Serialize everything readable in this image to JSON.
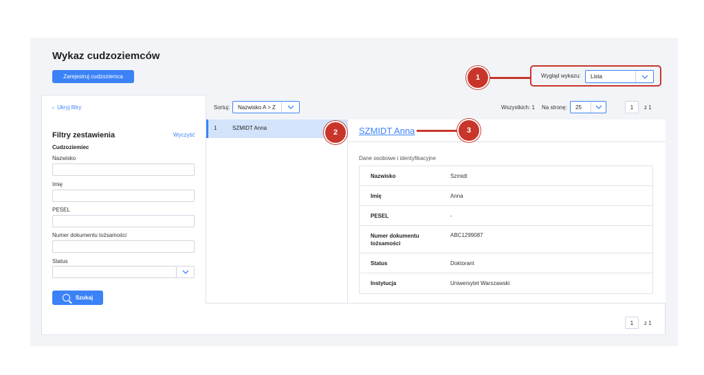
{
  "header": {
    "title": "Wykaz cudzoziemców",
    "register_label": "Zarejestruj cudzoziemca"
  },
  "view": {
    "label": "Wygląd wykazu:",
    "selected": "Lista"
  },
  "annotations": [
    "1",
    "2",
    "3"
  ],
  "filters": {
    "hide_label": "Ukryj filtry",
    "title": "Filtry zestawienia",
    "clear_label": "Wyczyść",
    "subtitle": "Cudzoziemiec",
    "fields": [
      {
        "label": "Nazwisko",
        "value": ""
      },
      {
        "label": "Imię",
        "value": ""
      },
      {
        "label": "PESEL",
        "value": ""
      },
      {
        "label": "Numer dokumentu tożsamości",
        "value": ""
      }
    ],
    "status_label": "Status",
    "status_value": "",
    "search_label": "Szukaj"
  },
  "toolbar": {
    "sort_label": "Sortuj:",
    "sort_value": "Nazwisko A > Z",
    "total_label": "Wszystkich: 1",
    "perpage_label": "Na stronę:",
    "perpage_value": "25",
    "page": "1",
    "page_of": "z 1"
  },
  "list": {
    "items": [
      {
        "num": "1",
        "name": "SZMIDT Anna"
      }
    ]
  },
  "detail": {
    "name": "SZMIDT Anna",
    "section_title": "Dane osobowe i identyfikacyjne",
    "rows": [
      {
        "key": "Nazwisko",
        "value": "Szmidt"
      },
      {
        "key": "Imię",
        "value": "Anna"
      },
      {
        "key": "PESEL",
        "value": "-"
      },
      {
        "key": "Numer dokumentu tożsamości",
        "value": "ABC1299087"
      },
      {
        "key": "Status",
        "value": "Doktorant"
      },
      {
        "key": "Instytucja",
        "value": "Uniwersytet Warszawski"
      }
    ]
  },
  "pagination_bottom": {
    "page": "1",
    "page_of": "z 1"
  },
  "colors": {
    "accent": "#3b82f6",
    "annotation": "#c8352a",
    "selected_row": "#d3e3fb"
  }
}
